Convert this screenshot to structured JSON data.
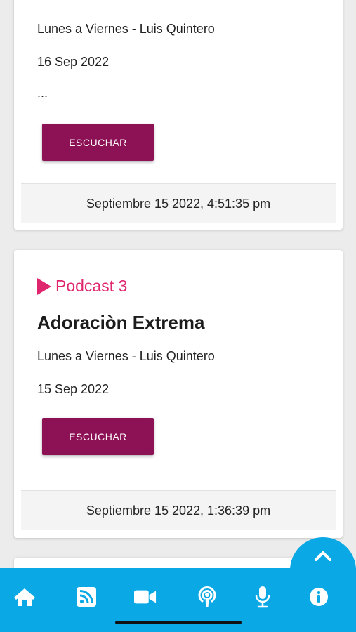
{
  "cards": [
    {
      "subtitle": "Lunes a Viernes - Luis Quintero",
      "date": "16 Sep 2022",
      "ellipsis": "...",
      "button_label": "ESCUCHAR",
      "timestamp": "Septiembre 15 2022, 4:51:35 pm"
    },
    {
      "podcast_label": "Podcast 3",
      "title": "Adoraciòn Extrema",
      "subtitle": "Lunes a Viernes - Luis Quintero",
      "date": "15 Sep 2022",
      "button_label": "ESCUCHAR",
      "timestamp": "Septiembre 15 2022, 1:36:39 pm"
    }
  ],
  "colors": {
    "accent_pink": "#e0256f",
    "button_maroon": "#8d1155",
    "nav_blue": "#0aa9e6"
  },
  "bottom_nav": {
    "items": [
      "home-icon",
      "rss-icon",
      "video-icon",
      "podcast-icon",
      "microphone-icon",
      "info-icon"
    ]
  }
}
